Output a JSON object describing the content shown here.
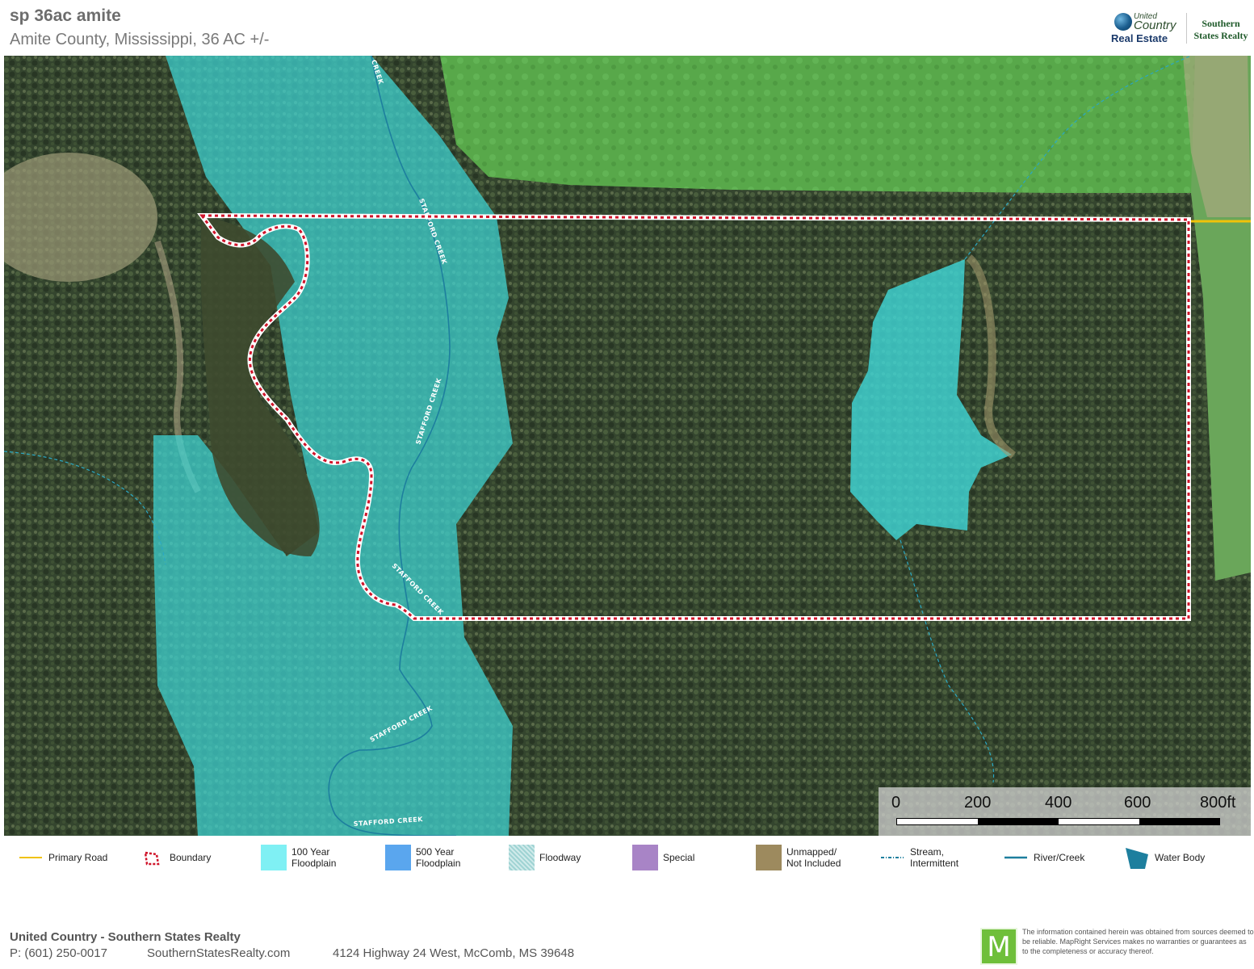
{
  "header": {
    "title": "sp 36ac amite",
    "subtitle": "Amite County, Mississippi, 36 AC +/-"
  },
  "logo": {
    "united": "United",
    "country": "Country",
    "real_estate": "Real Estate",
    "brand_line1": "Southern",
    "brand_line2": "States Realty"
  },
  "map": {
    "creek_labels": [
      "STAFFORD CREEK",
      "STAFFORD CREEK",
      "STAFFORD CREEK",
      "STAFFORD CREEK",
      "STAFFORD CREEK",
      "CREEK"
    ],
    "colors": {
      "floodplain_100": "#3fd6d6",
      "boundary": "#d0142a",
      "primary_road": "#f0c20a",
      "stream": "#2aa8c4"
    }
  },
  "scale": {
    "ticks": [
      "0",
      "200",
      "400",
      "600",
      "800ft"
    ]
  },
  "legend": [
    {
      "label": "Primary Road",
      "icon": "primary-road-line"
    },
    {
      "label": "Boundary",
      "icon": "boundary-polygon"
    },
    {
      "label": "100 Year\nFloodplain",
      "icon": "floodplain-100-swatch"
    },
    {
      "label": "500 Year\nFloodplain",
      "icon": "floodplain-500-swatch"
    },
    {
      "label": "Floodway",
      "icon": "floodway-swatch"
    },
    {
      "label": "Special",
      "icon": "special-swatch"
    },
    {
      "label": "Unmapped/\nNot Included",
      "icon": "unmapped-swatch"
    },
    {
      "label": "Stream,\nIntermittent",
      "icon": "stream-line"
    },
    {
      "label": "River/Creek",
      "icon": "river-line"
    },
    {
      "label": "Water Body",
      "icon": "water-body-shape"
    }
  ],
  "footer": {
    "company": "United Country - Southern States Realty",
    "phone": "P: (601) 250-0017",
    "website": "SouthernStatesRealty.com",
    "address": "4124 Highway 24 West, McComb, MS 39648",
    "badge_letter": "M",
    "disclaimer": "The information contained herein was obtained from sources deemed to be reliable. MapRight Services makes no warranties or guarantees as to the completeness or accuracy thereof."
  }
}
